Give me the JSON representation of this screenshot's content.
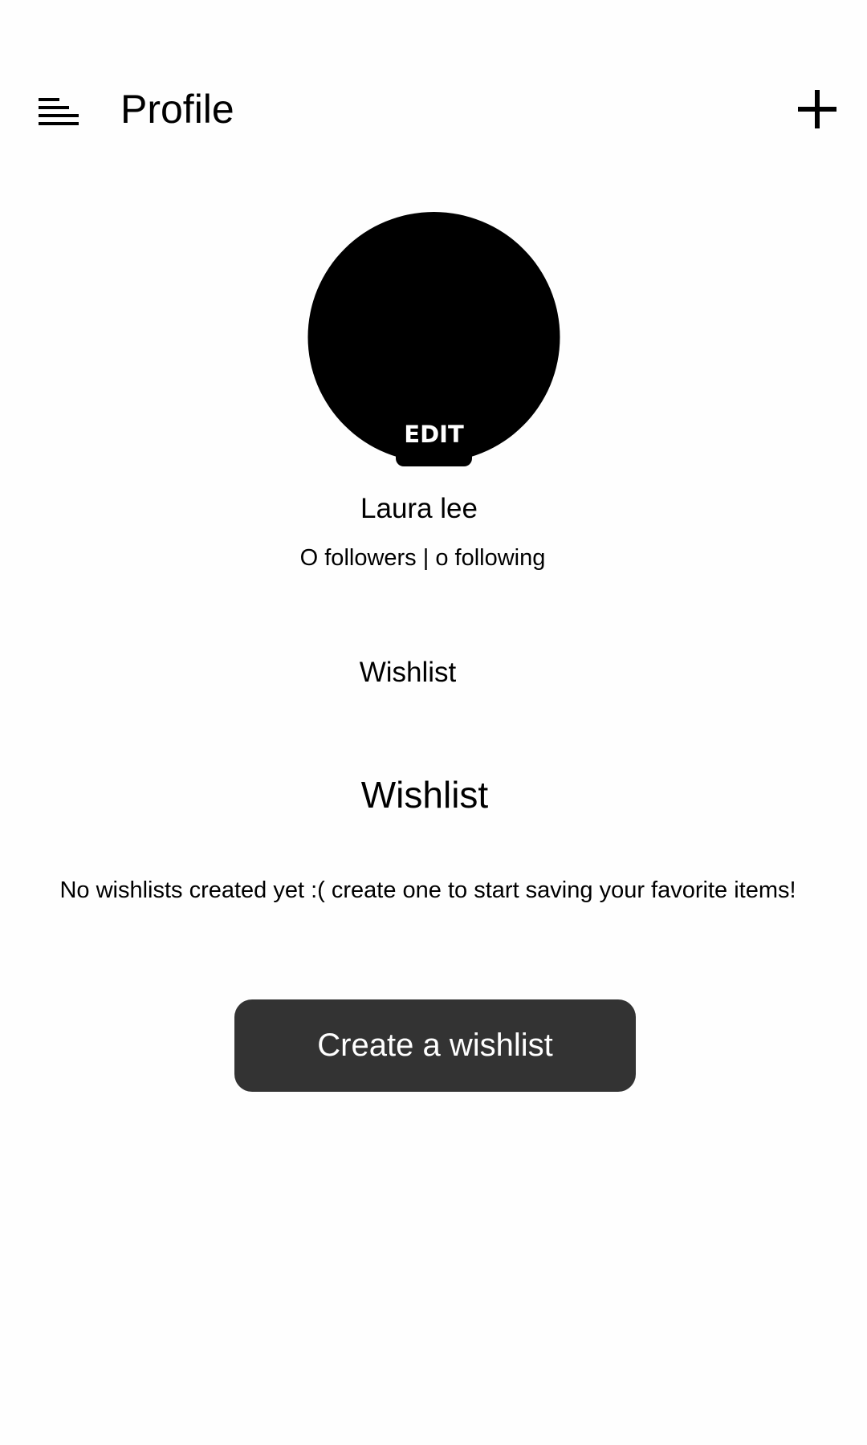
{
  "header": {
    "title": "Profile",
    "menu_icon": "menu-icon",
    "add_icon": "plus-icon"
  },
  "profile": {
    "avatar_edit_label": "EDIT",
    "name": "Laura lee",
    "stats": "O followers | o following"
  },
  "tabs": {
    "wishlist_label": "Wishlist"
  },
  "wishlist_section": {
    "heading": "Wishlist",
    "empty_message": "No wishlists created yet :( create one to start saving your favorite items!",
    "create_button_label": "Create a wishlist"
  },
  "colors": {
    "background": "#fefefe",
    "text": "#000000",
    "avatar_fill": "#000000",
    "button_background": "#333333",
    "button_text": "#ffffff"
  }
}
